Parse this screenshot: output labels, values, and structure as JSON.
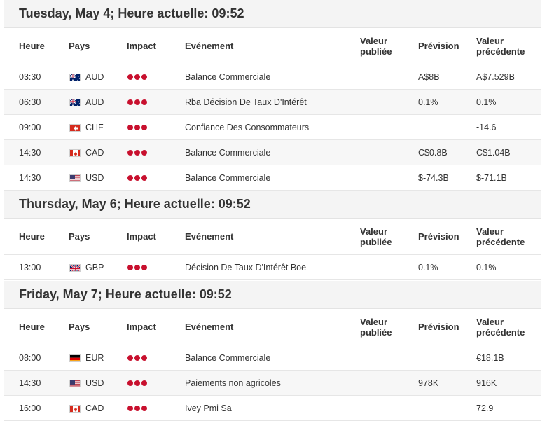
{
  "columns": {
    "time": "Heure",
    "country": "Pays",
    "impact": "Impact",
    "event": "Evénement",
    "actual_l1": "Valeur",
    "actual_l2": "publiée",
    "forecast": "Prévision",
    "previous_l1": "Valeur",
    "previous_l2": "précédente"
  },
  "days": [
    {
      "title": "Tuesday, May 4; Heure actuelle: 09:52",
      "rows": [
        {
          "time": "03:30",
          "flag": "aud-flag-icon",
          "currency": "AUD",
          "impact": 3,
          "event": "Balance Commerciale",
          "actual": "",
          "forecast": "A$8B",
          "previous": "A$7.529B"
        },
        {
          "time": "06:30",
          "flag": "aud-flag-icon",
          "currency": "AUD",
          "impact": 3,
          "event": "Rba Décision De Taux D'Intérêt",
          "actual": "",
          "forecast": "0.1%",
          "previous": "0.1%"
        },
        {
          "time": "09:00",
          "flag": "chf-flag-icon",
          "currency": "CHF",
          "impact": 3,
          "event": "Confiance Des Consommateurs",
          "actual": "",
          "forecast": "",
          "previous": "-14.6"
        },
        {
          "time": "14:30",
          "flag": "cad-flag-icon",
          "currency": "CAD",
          "impact": 3,
          "event": "Balance Commerciale",
          "actual": "",
          "forecast": "C$0.8B",
          "previous": "C$1.04B"
        },
        {
          "time": "14:30",
          "flag": "usd-flag-icon",
          "currency": "USD",
          "impact": 3,
          "event": "Balance Commerciale",
          "actual": "",
          "forecast": "$-74.3B",
          "previous": "$-71.1B"
        }
      ]
    },
    {
      "title": "Thursday, May 6; Heure actuelle: 09:52",
      "rows": [
        {
          "time": "13:00",
          "flag": "gbp-flag-icon",
          "currency": "GBP",
          "impact": 3,
          "event": "Décision De Taux D'Intérêt Boe",
          "actual": "",
          "forecast": "0.1%",
          "previous": "0.1%"
        }
      ]
    },
    {
      "title": "Friday, May 7; Heure actuelle: 09:52",
      "rows": [
        {
          "time": "08:00",
          "flag": "eur-flag-icon",
          "currency": "EUR",
          "impact": 3,
          "event": "Balance Commerciale",
          "actual": "",
          "forecast": "",
          "previous": "€18.1B"
        },
        {
          "time": "14:30",
          "flag": "usd-flag-icon",
          "currency": "USD",
          "impact": 3,
          "event": "Paiements non agricoles",
          "actual": "",
          "forecast": "978K",
          "previous": "916K"
        },
        {
          "time": "16:00",
          "flag": "cad-flag-icon",
          "currency": "CAD",
          "impact": 3,
          "event": "Ivey Pmi Sa",
          "actual": "",
          "forecast": "",
          "previous": "72.9"
        }
      ]
    }
  ],
  "colors": {
    "impact_dot": "#c8102e",
    "header_bg": "#f4f4f4",
    "row_alt_bg": "#f7f7f7"
  }
}
